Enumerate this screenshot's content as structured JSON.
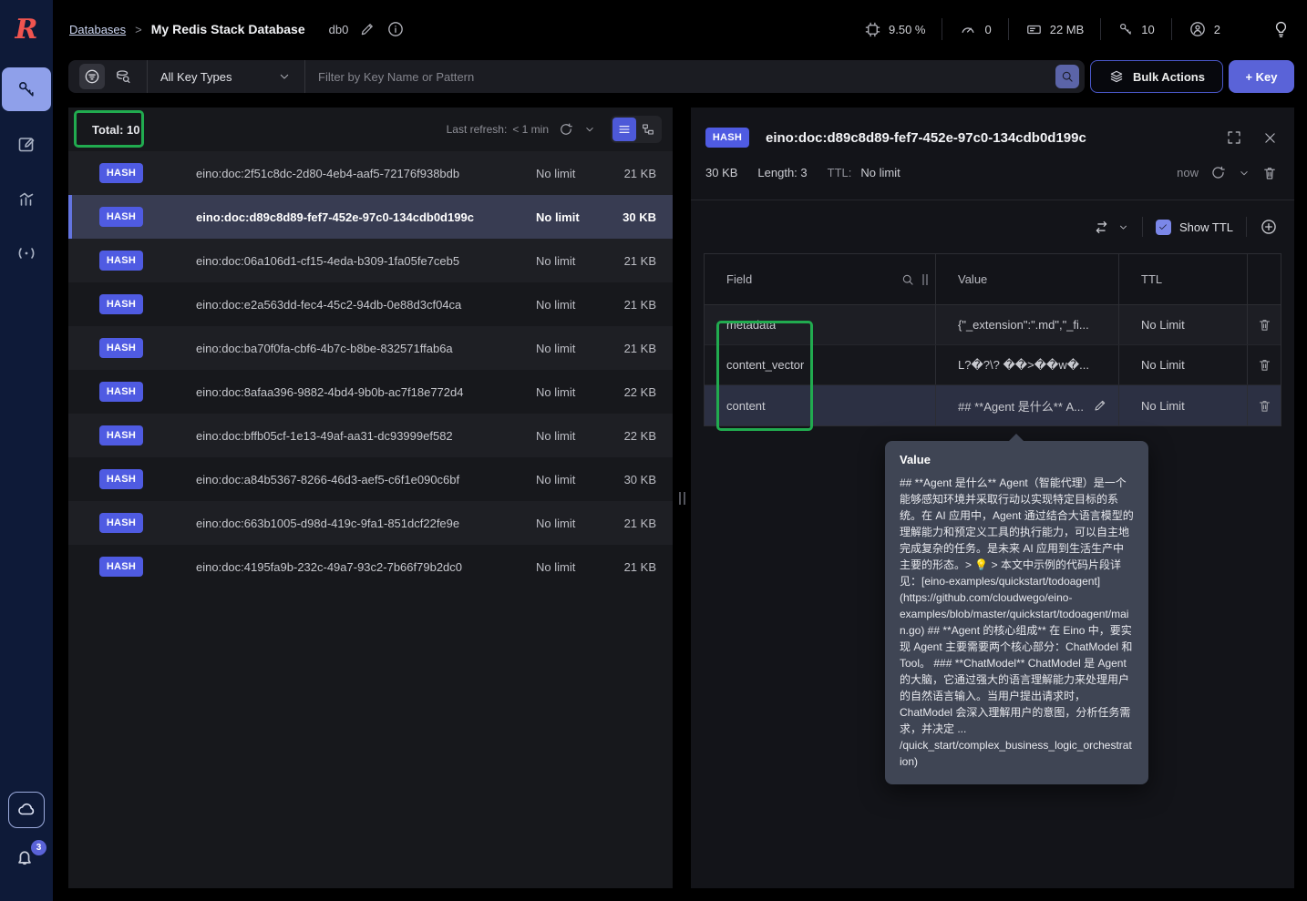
{
  "colors": {
    "accent": "#5a63d8",
    "badge": "#4f5be2",
    "annotation_green": "#21ab4f",
    "sidebar_navy": "#0e1a38"
  },
  "header": {
    "breadcrumb": {
      "root": "Databases",
      "separator": ">",
      "current": "My Redis Stack Database",
      "db": "db0"
    },
    "stats": {
      "cpu": "9.50 %",
      "commands": "0",
      "memory": "22 MB",
      "keys": "10",
      "users": "2"
    }
  },
  "filterbar": {
    "key_type_selector": "All Key Types",
    "search_placeholder": "Filter by Key Name or Pattern",
    "bulk_actions_label": "Bulk Actions",
    "add_key_label": "+ Key"
  },
  "key_list": {
    "total_label": "Total: 10",
    "last_refresh_label": "Last refresh:",
    "last_refresh_value": "< 1 min",
    "rows": [
      {
        "type": "HASH",
        "name": "eino:doc:2f51c8dc-2d80-4eb4-aaf5-72176f938bdb",
        "ttl": "No limit",
        "size": "21 KB"
      },
      {
        "type": "HASH",
        "name": "eino:doc:d89c8d89-fef7-452e-97c0-134cdb0d199c",
        "ttl": "No limit",
        "size": "30 KB",
        "state": "selected"
      },
      {
        "type": "HASH",
        "name": "eino:doc:06a106d1-cf15-4eda-b309-1fa05fe7ceb5",
        "ttl": "No limit",
        "size": "21 KB"
      },
      {
        "type": "HASH",
        "name": "eino:doc:e2a563dd-fec4-45c2-94db-0e88d3cf04ca",
        "ttl": "No limit",
        "size": "21 KB"
      },
      {
        "type": "HASH",
        "name": "eino:doc:ba70f0fa-cbf6-4b7c-b8be-832571ffab6a",
        "ttl": "No limit",
        "size": "21 KB"
      },
      {
        "type": "HASH",
        "name": "eino:doc:8afaa396-9882-4bd4-9b0b-ac7f18e772d4",
        "ttl": "No limit",
        "size": "22 KB"
      },
      {
        "type": "HASH",
        "name": "eino:doc:bffb05cf-1e13-49af-aa31-dc93999ef582",
        "ttl": "No limit",
        "size": "22 KB"
      },
      {
        "type": "HASH",
        "name": "eino:doc:a84b5367-8266-46d3-aef5-c6f1e090c6bf",
        "ttl": "No limit",
        "size": "30 KB"
      },
      {
        "type": "HASH",
        "name": "eino:doc:663b1005-d98d-419c-9fa1-851dcf22fe9e",
        "ttl": "No limit",
        "size": "21 KB"
      },
      {
        "type": "HASH",
        "name": "eino:doc:4195fa9b-232c-49a7-93c2-7b66f79b2dc0",
        "ttl": "No limit",
        "size": "21 KB"
      }
    ]
  },
  "detail": {
    "type_badge": "HASH",
    "key_name": "eino:doc:d89c8d89-fef7-452e-97c0-134cdb0d199c",
    "size": "30 KB",
    "length_label": "Length: 3",
    "ttl_label": "TTL:",
    "ttl_value": "No limit",
    "refreshed": "now",
    "show_ttl_label": "Show TTL",
    "table": {
      "headers": {
        "field": "Field",
        "value": "Value",
        "ttl": "TTL"
      },
      "rows": [
        {
          "field": "metadata",
          "value": "{\"_extension\":\".md\",\"_fi...",
          "ttl": "No Limit"
        },
        {
          "field": "content_vector",
          "value": "L?�?\\? ��>��w�...",
          "ttl": "No Limit"
        },
        {
          "field": "content",
          "value": "## **Agent 是什么** A...",
          "ttl": "No Limit",
          "state": "active"
        }
      ]
    },
    "tooltip": {
      "title": "Value",
      "body": "## **Agent 是什么** Agent（智能代理）是一个能够感知环境并采取行动以实现特定目标的系统。在 AI 应用中，Agent 通过结合大语言模型的理解能力和预定义工具的执行能力，可以自主地完成复杂的任务。是未来 AI 应用到生活生产中主要的形态。> 💡 > 本文中示例的代码片段详见：[eino-examples/quickstart/todoagent](https://github.com/cloudwego/eino-examples/blob/master/quickstart/todoagent/main.go) ## **Agent 的核心组成** 在 Eino 中，要实现 Agent 主要需要两个核心部分：ChatModel 和 Tool。 ### **ChatModel** ChatModel 是 Agent 的大脑，它通过强大的语言理解能力来处理用户的自然语言输入。当用户提出请求时，ChatModel 会深入理解用户的意图，分析任务需求，并决定 ... /quick_start/complex_business_logic_orchestration)"
    }
  },
  "sidebar": {
    "logo_letter": "R",
    "notifications_badge": "3"
  }
}
